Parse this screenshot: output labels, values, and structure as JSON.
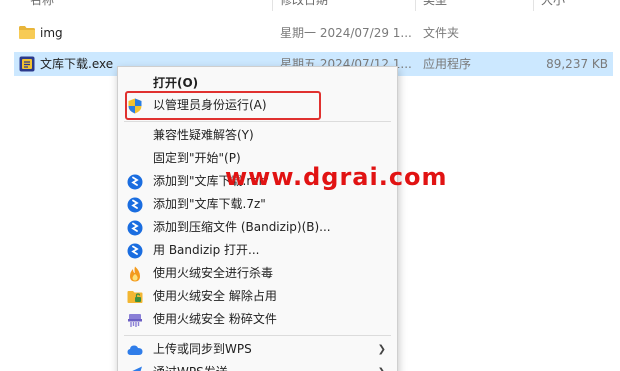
{
  "header": {
    "col_name": "名称",
    "col_modified": "修改日期",
    "col_type": "类型",
    "col_size": "大小"
  },
  "files": [
    {
      "name": "img",
      "modified": "星期一 2024/07/29 1...",
      "type": "文件夹",
      "size": "",
      "icon": "folder-icon"
    },
    {
      "name": "文库下载.exe",
      "modified": "星期五 2024/07/12 1...",
      "type": "应用程序",
      "size": "89,237 KB",
      "icon": "exe-icon"
    }
  ],
  "menu": {
    "open": "打开(O)",
    "run_as_admin": "以管理员身份运行(A)",
    "compat": "兼容性疑难解答(Y)",
    "pin_start": "固定到\"开始\"(P)",
    "add_rar": "添加到\"文库下载.rar\"",
    "add_7z": "添加到\"文库下载.7z\"",
    "add_archive": "添加到压缩文件 (Bandizip)(B)...",
    "open_bandizip": "用 Bandizip 打开...",
    "huorong_scan": "使用火绒安全进行杀毒",
    "huorong_unlock": "使用火绒安全 解除占用",
    "huorong_shred": "使用火绒安全 粉碎文件",
    "wps_sync": "上传或同步到WPS",
    "wps_send": "通过WPS发送"
  },
  "watermark": "www.dgrai.com",
  "colors": {
    "selection": "#cce8ff",
    "highlight_box": "#e0312f",
    "watermark": "#e11313",
    "bandizip_blue": "#1a6de0"
  }
}
